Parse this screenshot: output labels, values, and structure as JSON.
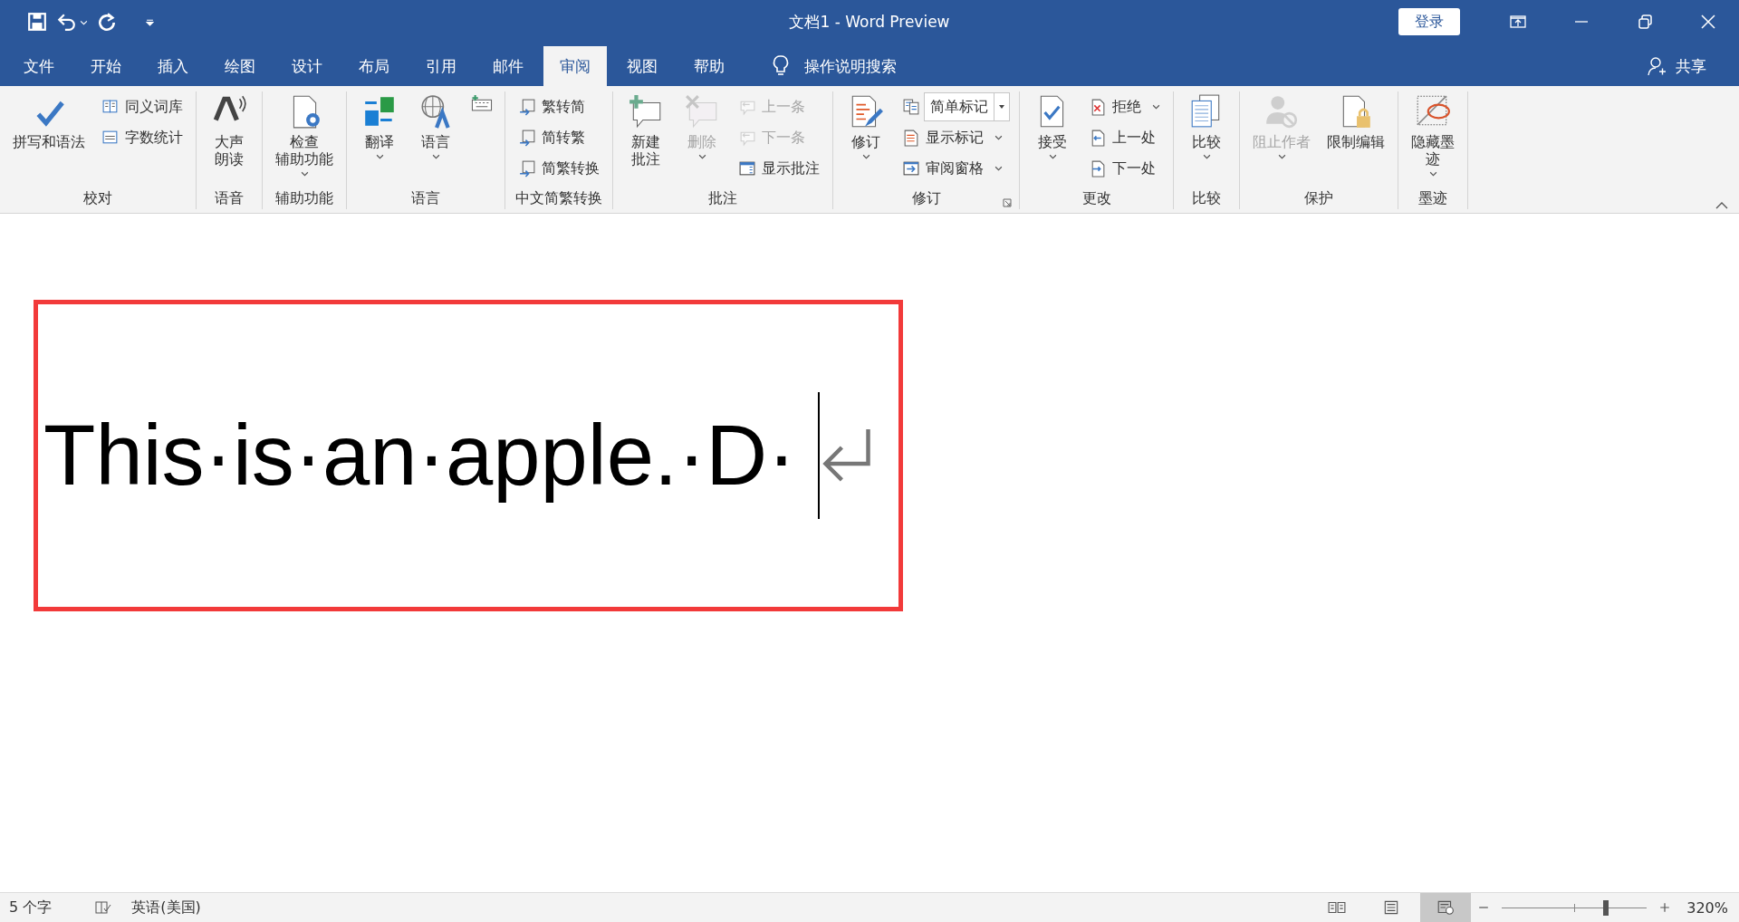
{
  "window": {
    "title": "文档1  -  Word Preview",
    "signin": "登录"
  },
  "tabs": [
    {
      "label": "文件",
      "selected": false
    },
    {
      "label": "开始",
      "selected": false
    },
    {
      "label": "插入",
      "selected": false
    },
    {
      "label": "绘图",
      "selected": false
    },
    {
      "label": "设计",
      "selected": false
    },
    {
      "label": "布局",
      "selected": false
    },
    {
      "label": "引用",
      "selected": false
    },
    {
      "label": "邮件",
      "selected": false
    },
    {
      "label": "审阅",
      "selected": true
    },
    {
      "label": "视图",
      "selected": false
    },
    {
      "label": "帮助",
      "selected": false
    }
  ],
  "tell_me": {
    "placeholder": "操作说明搜索"
  },
  "share": "共享",
  "ribbon_groups": [
    {
      "name": "校对",
      "launcher": false,
      "items": [
        {
          "kind": "large",
          "lines": [
            "拼写和语法"
          ],
          "disabled": false,
          "menu": false
        },
        {
          "kind": "small",
          "lines": [
            "同义词库"
          ],
          "disabled": false,
          "menu": false
        },
        {
          "kind": "small",
          "lines": [
            "字数统计"
          ],
          "disabled": false,
          "menu": false
        }
      ]
    },
    {
      "name": "语音",
      "launcher": false,
      "items": [
        {
          "kind": "large",
          "lines": [
            "大声",
            "朗读"
          ],
          "disabled": false,
          "menu": false
        }
      ]
    },
    {
      "name": "辅助功能",
      "launcher": false,
      "items": [
        {
          "kind": "large",
          "lines": [
            "检查",
            "辅助功能"
          ],
          "disabled": false,
          "menu": true
        }
      ]
    },
    {
      "name": "语言",
      "launcher": false,
      "items": [
        {
          "kind": "large",
          "lines": [
            "翻译"
          ],
          "disabled": false,
          "menu": true
        },
        {
          "kind": "large",
          "lines": [
            "语言"
          ],
          "disabled": false,
          "menu": true
        },
        {
          "kind": "icon",
          "disabled": false,
          "menu": false
        }
      ]
    },
    {
      "name": "中文简繁转换",
      "launcher": false,
      "items": [
        {
          "kind": "small",
          "lines": [
            "繁转简"
          ],
          "disabled": false,
          "menu": false
        },
        {
          "kind": "small",
          "lines": [
            "简转繁"
          ],
          "disabled": false,
          "menu": false
        },
        {
          "kind": "small",
          "lines": [
            "简繁转换"
          ],
          "disabled": false,
          "menu": false
        }
      ]
    },
    {
      "name": "批注",
      "launcher": false,
      "items": [
        {
          "kind": "large",
          "lines": [
            "新建",
            "批注"
          ],
          "disabled": false,
          "menu": false
        },
        {
          "kind": "large",
          "lines": [
            "删除"
          ],
          "disabled": true,
          "menu": true
        },
        {
          "kind": "small",
          "lines": [
            "上一条"
          ],
          "disabled": true,
          "menu": false
        },
        {
          "kind": "small",
          "lines": [
            "下一条"
          ],
          "disabled": true,
          "menu": false
        },
        {
          "kind": "small",
          "lines": [
            "显示批注"
          ],
          "disabled": false,
          "menu": false
        }
      ]
    },
    {
      "name": "修订",
      "launcher": true,
      "items": [
        {
          "kind": "large",
          "lines": [
            "修订"
          ],
          "disabled": false,
          "menu": true
        },
        {
          "kind": "select",
          "lines": [
            "简单标记"
          ],
          "disabled": false,
          "menu": true
        },
        {
          "kind": "small",
          "lines": [
            "显示标记"
          ],
          "disabled": false,
          "menu": true
        },
        {
          "kind": "small",
          "lines": [
            "审阅窗格"
          ],
          "disabled": false,
          "menu": true
        }
      ]
    },
    {
      "name": "更改",
      "launcher": false,
      "items": [
        {
          "kind": "large",
          "lines": [
            "接受"
          ],
          "disabled": false,
          "menu": true
        },
        {
          "kind": "small",
          "lines": [
            "拒绝"
          ],
          "disabled": false,
          "menu": true
        },
        {
          "kind": "small",
          "lines": [
            "上一处"
          ],
          "disabled": false,
          "menu": false
        },
        {
          "kind": "small",
          "lines": [
            "下一处"
          ],
          "disabled": false,
          "menu": false
        }
      ]
    },
    {
      "name": "比较",
      "launcher": false,
      "items": [
        {
          "kind": "large",
          "lines": [
            "比较"
          ],
          "disabled": false,
          "menu": true
        }
      ]
    },
    {
      "name": "保护",
      "launcher": false,
      "items": [
        {
          "kind": "large",
          "lines": [
            "阻止作者"
          ],
          "disabled": true,
          "menu": true
        },
        {
          "kind": "large",
          "lines": [
            "限制编辑"
          ],
          "disabled": false,
          "menu": false
        }
      ]
    },
    {
      "name": "墨迹",
      "launcher": false,
      "items": [
        {
          "kind": "large",
          "lines": [
            "隐藏墨",
            "迹"
          ],
          "disabled": false,
          "menu": true
        }
      ]
    }
  ],
  "document": {
    "text": "This·is·an·apple.·D·",
    "highlighted": true
  },
  "status_bar": {
    "word_count": "5 个字",
    "language": "英语(美国)",
    "views": [
      {
        "selected": false
      },
      {
        "selected": false
      },
      {
        "selected": true
      }
    ],
    "zoom": {
      "level": 0.72,
      "reading": "320%"
    }
  }
}
